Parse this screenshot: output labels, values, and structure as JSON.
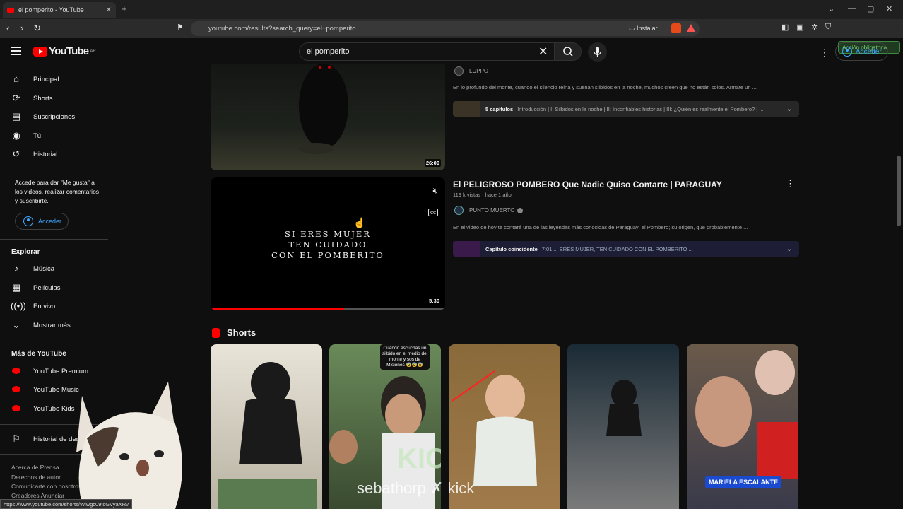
{
  "browser": {
    "tab_title": "el pomperito - YouTube",
    "tab_close": "✕",
    "new_tab": "+",
    "url": "youtube.com/results?search_query=el+pomperito",
    "install_label": "Instalar",
    "action_label": "Acción obligatoria",
    "status_url": "https://www.youtube.com/shorts/Wlwgc09tcGVyaXRv"
  },
  "header": {
    "logo_text": "YouTube",
    "logo_region": "AR",
    "search_value": "el pomperito",
    "signin_label": "Acceder"
  },
  "sidebar": {
    "main_items": [
      {
        "label": "Principal",
        "icon": "home-icon"
      },
      {
        "label": "Shorts",
        "icon": "shorts-icon"
      },
      {
        "label": "Suscripciones",
        "icon": "subscriptions-icon"
      },
      {
        "label": "Tú",
        "icon": "you-icon"
      },
      {
        "label": "Historial",
        "icon": "history-icon"
      }
    ],
    "signin_prompt": "Accede para dar \"Me gusta\" a los videos, realizar comentarios y suscribirte.",
    "signin_button": "Acceder",
    "explore_heading": "Explorar",
    "explore_items": [
      {
        "label": "Música",
        "icon": "music-icon"
      },
      {
        "label": "Películas",
        "icon": "movies-icon"
      },
      {
        "label": "En vivo",
        "icon": "live-icon"
      },
      {
        "label": "Mostrar más",
        "icon": "chevron-down-icon"
      }
    ],
    "more_heading": "Más de YouTube",
    "more_items": [
      {
        "label": "YouTube Premium"
      },
      {
        "label": "YouTube Music"
      },
      {
        "label": "YouTube Kids"
      }
    ],
    "report_history": "Historial de denuncias",
    "footer_links": [
      "Acerca de  Prensa",
      "Derechos de autor",
      "Comunicarte con nosotros",
      "Creadores  Anunciar"
    ]
  },
  "results": [
    {
      "channel": "LUPPO",
      "description": "En lo profundo del monte, cuando el silencio reina y suenan silbidos en la noche, muchos creen que no están solos. Armate un ...",
      "duration": "26:09",
      "chapters_count": "5 capítulos",
      "chapters_text": "Introducción | I: Silbidos en la noche | II: Inconfiables historias | III: ¿Quién es realmente el Pombero? | ..."
    },
    {
      "title": "El PELIGROSO POMBERO Que Nadie Quiso Contarte | PARAGUAY",
      "meta": "119 k vistas · hace 1 año",
      "channel": "PUNTO MUERTO",
      "description": "En el video de hoy te contaré una de las leyendas más conocidas de Paraguay: el Pombero; su origen, que probablemente ...",
      "duration": "5:30",
      "thumb_text": [
        "SI ERES MUJER",
        "TEN CUIDADO",
        "CON EL POMBERITO"
      ],
      "chapter_label": "Capítulo coincidente",
      "chapter_text": "7:01 ... ERES MUJER, TEN CUIDADO CON EL POMBERITO ...",
      "progress": 0.57
    }
  ],
  "shorts": {
    "heading": "Shorts",
    "cards": [
      {
        "overlay": ""
      },
      {
        "overlay": "Cuando escuchas un silbido en el medio del monte y sos de Misiones 😨😨😨",
        "caption": "KICK"
      },
      {
        "overlay": "sebathorp ✗ kick"
      },
      {
        "overlay": ""
      },
      {
        "overlay": "MARIELA ESCALANTE"
      }
    ]
  },
  "colors": {
    "brand_red": "#ff0000",
    "link_blue": "#3ea6ff",
    "background": "#0f0f0f"
  }
}
